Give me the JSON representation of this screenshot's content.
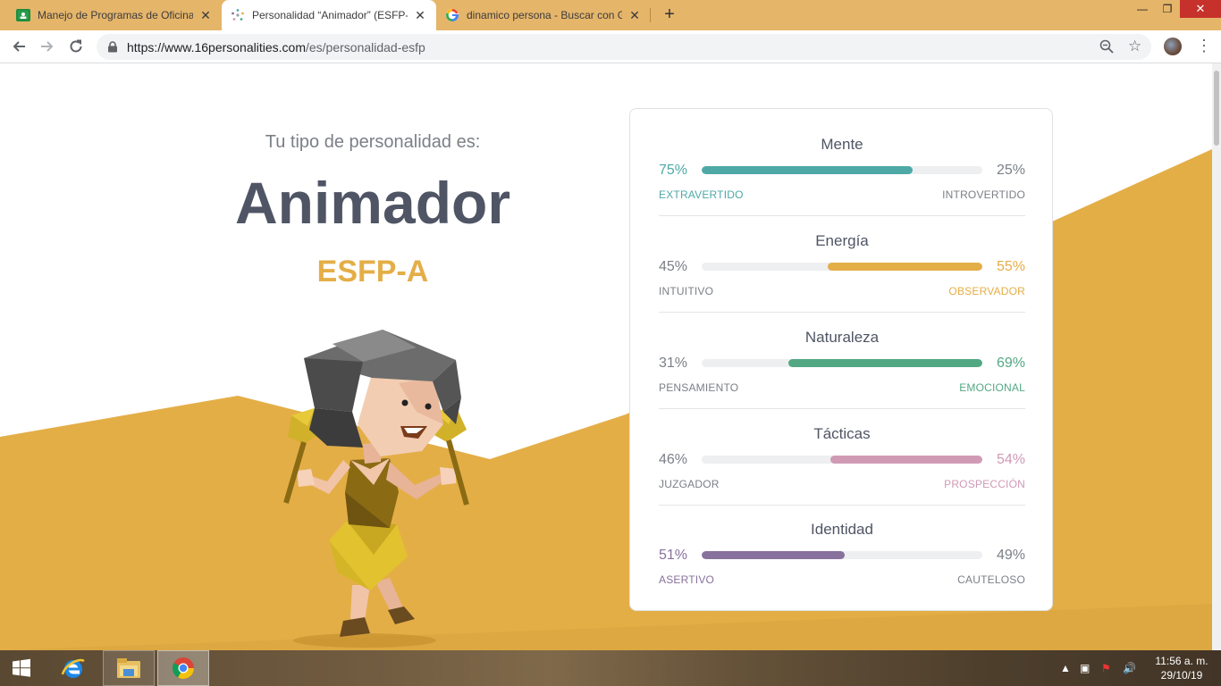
{
  "colors": {
    "brand_gold": "#e4ae47",
    "mind": "#4ea9a6",
    "energy": "#e4ae47",
    "nature": "#52a883",
    "tactics": "#d09ab4",
    "identity": "#88719d"
  },
  "browser": {
    "tabs": [
      {
        "title": "Manejo de Programas de Oficina",
        "icon": "google-classroom-icon"
      },
      {
        "title": "Personalidad “Animador” (ESFP-A",
        "icon": "16personalities-icon"
      },
      {
        "title": "dinamico persona - Buscar con G",
        "icon": "google-icon"
      }
    ],
    "url_host": "https://www.16personalities.com",
    "url_path": "/es/personalidad-esfp"
  },
  "hero": {
    "intro": "Tu tipo de personalidad es:",
    "name": "Animador",
    "code": "ESFP-A"
  },
  "traits": [
    {
      "title": "Mente",
      "left_pct": "75%",
      "right_pct": "25%",
      "left_label": "EXTRAVERTIDO",
      "right_label": "INTROVERTIDO",
      "dominant": "left",
      "value": 0.75,
      "color": "#4ea9a6"
    },
    {
      "title": "Energía",
      "left_pct": "45%",
      "right_pct": "55%",
      "left_label": "INTUITIVO",
      "right_label": "OBSERVADOR",
      "dominant": "right",
      "value": 0.55,
      "color": "#e4ae47"
    },
    {
      "title": "Naturaleza",
      "left_pct": "31%",
      "right_pct": "69%",
      "left_label": "PENSAMIENTO",
      "right_label": "EMOCIONAL",
      "dominant": "right",
      "value": 0.69,
      "color": "#52a883"
    },
    {
      "title": "Tácticas",
      "left_pct": "46%",
      "right_pct": "54%",
      "left_label": "JUZGADOR",
      "right_label": "PROSPECCIÓN",
      "dominant": "right",
      "value": 0.54,
      "color": "#d09ab4"
    },
    {
      "title": "Identidad",
      "left_pct": "51%",
      "right_pct": "49%",
      "left_label": "ASERTIVO",
      "right_label": "CAUTELOSO",
      "dominant": "left",
      "value": 0.51,
      "color": "#88719d"
    }
  ],
  "taskbar": {
    "time": "11:56 a. m.",
    "date": "29/10/19"
  }
}
